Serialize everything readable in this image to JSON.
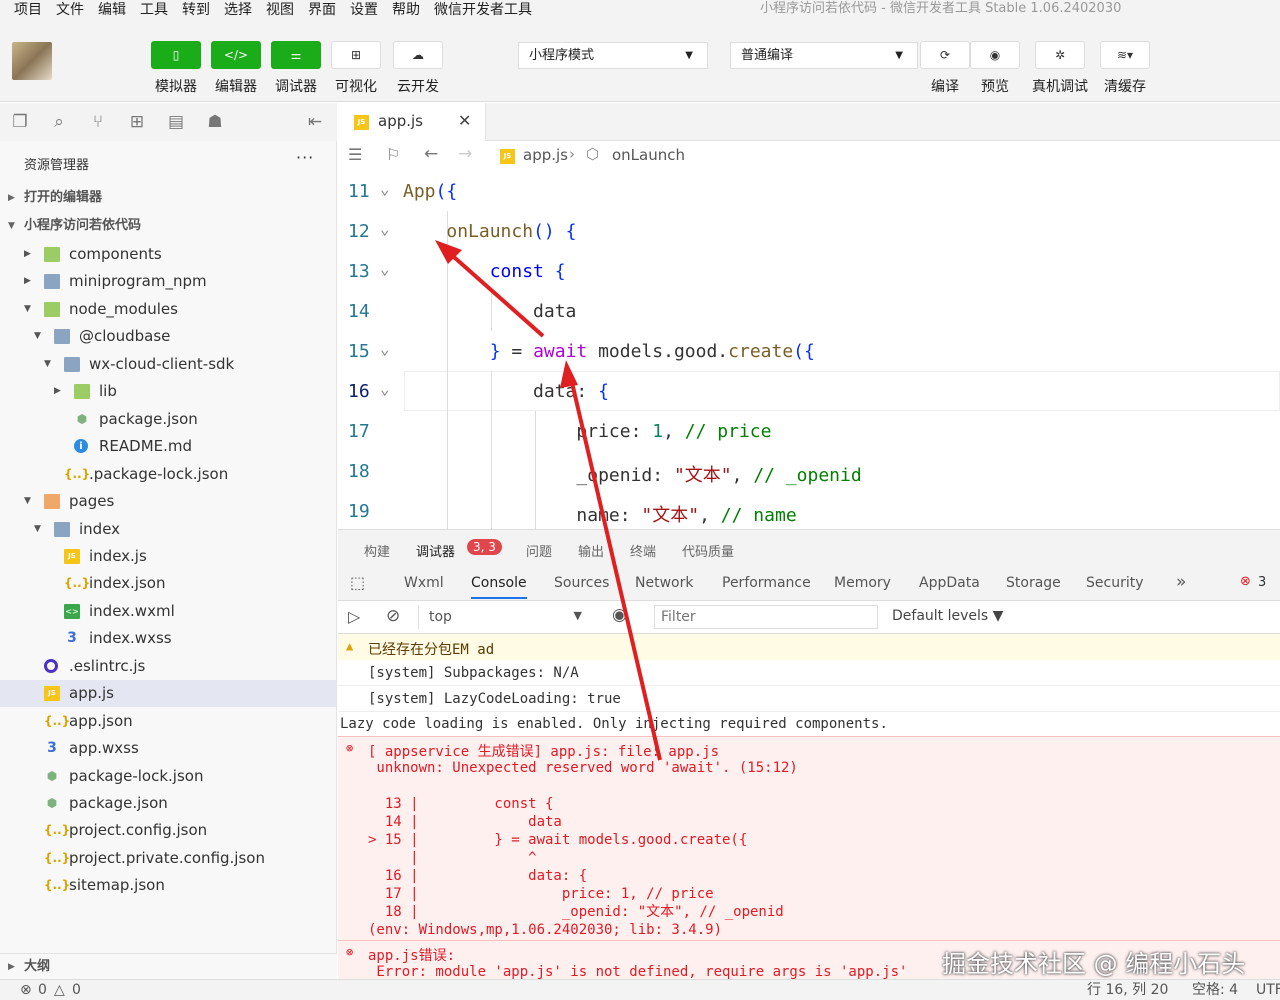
{
  "menu": [
    "项目",
    "文件",
    "编辑",
    "工具",
    "转到",
    "选择",
    "视图",
    "界面",
    "设置",
    "帮助",
    "微信开发者工具"
  ],
  "window_title": "小程序访问若依代码 - 微信开发者工具 Stable 1.06.2402030",
  "toolbar": {
    "simulator": "模拟器",
    "editor": "编辑器",
    "debugger": "调试器",
    "visual": "可视化",
    "cloud": "云开发",
    "mode_select": "小程序模式",
    "compile_select": "普通编译",
    "compile": "编译",
    "preview": "预览",
    "device_debug": "真机调试",
    "clear_cache": "清缓存"
  },
  "explorer": {
    "title": "资源管理器",
    "more": "···",
    "open_editors": "打开的编辑器",
    "project": "小程序访问若依代码",
    "outline": "大纲",
    "items": [
      {
        "name": "components",
        "icon": "folder-green",
        "indent": 0,
        "twisty": "right"
      },
      {
        "name": "miniprogram_npm",
        "icon": "folder",
        "indent": 0,
        "twisty": "right"
      },
      {
        "name": "node_modules",
        "icon": "folder-green",
        "indent": 0,
        "twisty": "down"
      },
      {
        "name": "@cloudbase",
        "icon": "folder",
        "indent": 1,
        "twisty": "down"
      },
      {
        "name": "wx-cloud-client-sdk",
        "icon": "folder",
        "indent": 2,
        "twisty": "down"
      },
      {
        "name": "lib",
        "icon": "folder-green",
        "indent": 3,
        "twisty": "right"
      },
      {
        "name": "package.json",
        "icon": "pkg",
        "indent": 3,
        "twisty": ""
      },
      {
        "name": "README.md",
        "icon": "info",
        "indent": 3,
        "twisty": ""
      },
      {
        "name": ".package-lock.json",
        "icon": "json",
        "indent": 2,
        "twisty": ""
      },
      {
        "name": "pages",
        "icon": "folder-orange",
        "indent": 0,
        "twisty": "down"
      },
      {
        "name": "index",
        "icon": "folder",
        "indent": 1,
        "twisty": "down"
      },
      {
        "name": "index.js",
        "icon": "js",
        "indent": 2,
        "twisty": ""
      },
      {
        "name": "index.json",
        "icon": "json",
        "indent": 2,
        "twisty": ""
      },
      {
        "name": "index.wxml",
        "icon": "wxml",
        "indent": 2,
        "twisty": ""
      },
      {
        "name": "index.wxss",
        "icon": "wxss",
        "indent": 2,
        "twisty": ""
      },
      {
        "name": ".eslintrc.js",
        "icon": "eslint",
        "indent": 0,
        "twisty": ""
      },
      {
        "name": "app.js",
        "icon": "js",
        "indent": 0,
        "twisty": "",
        "selected": true
      },
      {
        "name": "app.json",
        "icon": "json",
        "indent": 0,
        "twisty": ""
      },
      {
        "name": "app.wxss",
        "icon": "wxss",
        "indent": 0,
        "twisty": ""
      },
      {
        "name": "package-lock.json",
        "icon": "pkg",
        "indent": 0,
        "twisty": ""
      },
      {
        "name": "package.json",
        "icon": "pkg",
        "indent": 0,
        "twisty": ""
      },
      {
        "name": "project.config.json",
        "icon": "json",
        "indent": 0,
        "twisty": ""
      },
      {
        "name": "project.private.config.json",
        "icon": "json",
        "indent": 0,
        "twisty": ""
      },
      {
        "name": "sitemap.json",
        "icon": "json",
        "indent": 0,
        "twisty": ""
      }
    ]
  },
  "editor": {
    "tab_label": "app.js",
    "breadcrumb_file": "app.js",
    "breadcrumb_symbol": "onLaunch"
  },
  "code_lines": [
    {
      "n": "11",
      "fold": true
    },
    {
      "n": "12",
      "fold": true
    },
    {
      "n": "13",
      "fold": true
    },
    {
      "n": "14",
      "fold": false
    },
    {
      "n": "15",
      "fold": true
    },
    {
      "n": "16",
      "fold": true
    },
    {
      "n": "17",
      "fold": false
    },
    {
      "n": "18",
      "fold": false
    },
    {
      "n": "19",
      "fold": false
    }
  ],
  "panel_tabs": [
    "构建",
    "调试器",
    "问题",
    "输出",
    "终端",
    "代码质量"
  ],
  "panel_badge": "3, 3",
  "dev_tabs": [
    "Wxml",
    "Console",
    "Sources",
    "Network",
    "Performance",
    "Memory",
    "AppData",
    "Storage",
    "Security"
  ],
  "dev_more": "»",
  "error_count": "3",
  "console_toolbar": {
    "context": "top",
    "filter_placeholder": "Filter",
    "levels": "Default levels ▼"
  },
  "console": {
    "warn": "已经存在分包EM ad",
    "sys1": "[system] Subpackages: N/A",
    "sys2": "[system] LazyCodeLoading: true",
    "lazy": "Lazy code loading is enabled. Only injecting required components.",
    "err_head": "[ appservice 生成错误] app.js: file: app.js",
    "err_msg": " unknown: Unexpected reserved word 'await'. (15:12)",
    "frame": [
      "  13 |         const {",
      "  14 |             data",
      "> 15 |         } = await models.good.create({",
      "     |             ^",
      "  16 |             data: {",
      "  17 |                 price: 1, // price",
      "  18 |                 _openid: \"文本\", // _openid"
    ],
    "env": "(env: Windows,mp,1.06.2402030; lib: 3.4.9)",
    "err2": "app.js错误:",
    "err2_sub": " Error: module 'app.js' is not defined, require args is 'app.js'"
  },
  "status": {
    "errors": "0",
    "warnings": "0",
    "position": "行 16, 列 20",
    "spaces": "空格: 4",
    "encoding": "UTF"
  },
  "watermark": "掘金技术社区 @ 编程小石头"
}
